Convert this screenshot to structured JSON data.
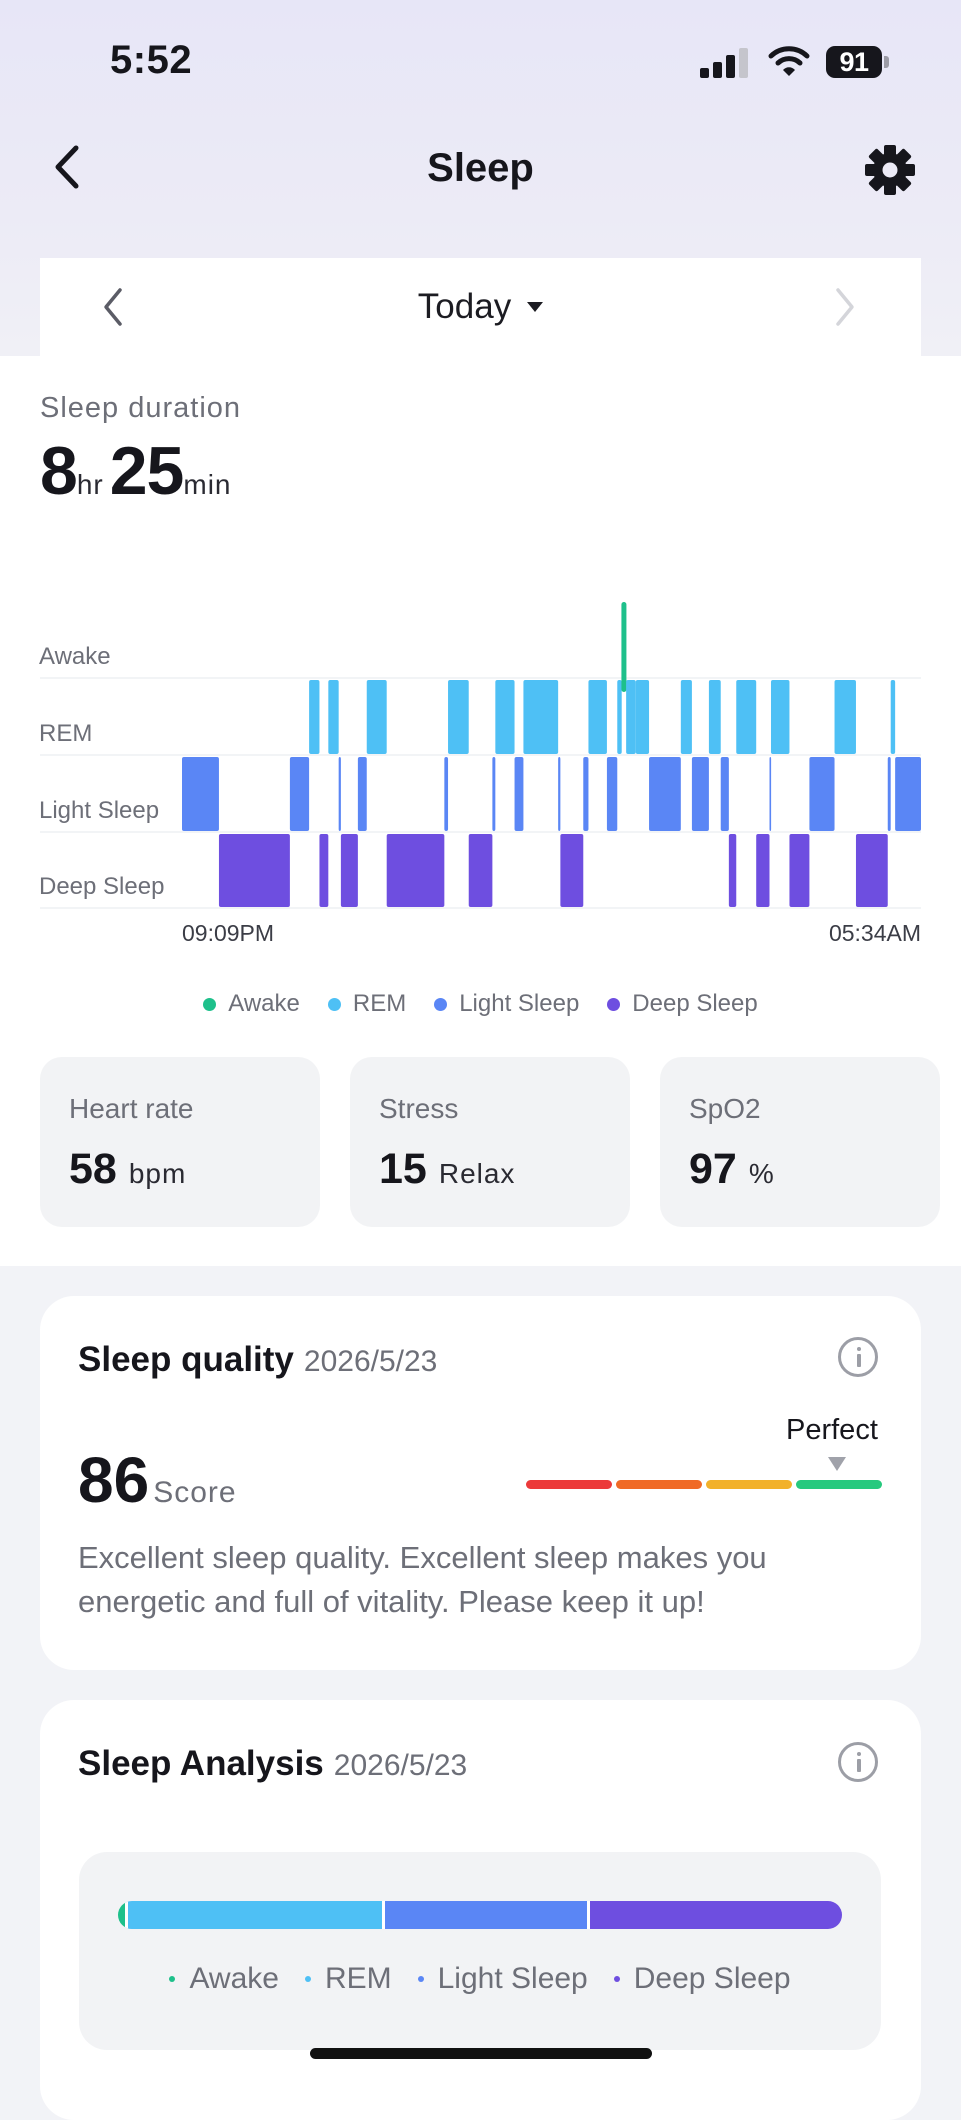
{
  "status_bar": {
    "time": "5:52",
    "battery": "91"
  },
  "header": {
    "title": "Sleep"
  },
  "date_nav": {
    "label": "Today"
  },
  "duration": {
    "label": "Sleep duration",
    "hours": "8",
    "hours_unit": "hr",
    "minutes": "25",
    "minutes_unit": "min"
  },
  "colors": {
    "awake": "#1ec08b",
    "rem": "#4ec0f5",
    "light": "#5a86f5",
    "deep": "#6e4ee0"
  },
  "chart_data": {
    "type": "timeline",
    "stages": [
      "Awake",
      "REM",
      "Light Sleep",
      "Deep Sleep"
    ],
    "start_label": "09:09PM",
    "end_label": "05:34AM",
    "segments": [
      {
        "stage": "Light Sleep",
        "start": 0.0,
        "end": 0.05
      },
      {
        "stage": "Deep Sleep",
        "start": 0.05,
        "end": 0.146
      },
      {
        "stage": "Light Sleep",
        "start": 0.146,
        "end": 0.172
      },
      {
        "stage": "REM",
        "start": 0.172,
        "end": 0.186
      },
      {
        "stage": "Deep Sleep",
        "start": 0.186,
        "end": 0.198
      },
      {
        "stage": "REM",
        "start": 0.198,
        "end": 0.212
      },
      {
        "stage": "Light Sleep",
        "start": 0.212,
        "end": 0.215
      },
      {
        "stage": "Deep Sleep",
        "start": 0.215,
        "end": 0.238
      },
      {
        "stage": "Light Sleep",
        "start": 0.238,
        "end": 0.25
      },
      {
        "stage": "REM",
        "start": 0.25,
        "end": 0.277
      },
      {
        "stage": "Deep Sleep",
        "start": 0.277,
        "end": 0.355
      },
      {
        "stage": "Light Sleep",
        "start": 0.355,
        "end": 0.36
      },
      {
        "stage": "REM",
        "start": 0.36,
        "end": 0.388
      },
      {
        "stage": "Deep Sleep",
        "start": 0.388,
        "end": 0.42
      },
      {
        "stage": "Light Sleep",
        "start": 0.42,
        "end": 0.424
      },
      {
        "stage": "REM",
        "start": 0.424,
        "end": 0.45
      },
      {
        "stage": "Light Sleep",
        "start": 0.45,
        "end": 0.462
      },
      {
        "stage": "REM",
        "start": 0.462,
        "end": 0.509
      },
      {
        "stage": "Light Sleep",
        "start": 0.509,
        "end": 0.512
      },
      {
        "stage": "Deep Sleep",
        "start": 0.512,
        "end": 0.543
      },
      {
        "stage": "Light Sleep",
        "start": 0.543,
        "end": 0.55
      },
      {
        "stage": "REM",
        "start": 0.55,
        "end": 0.575
      },
      {
        "stage": "Light Sleep",
        "start": 0.575,
        "end": 0.589
      },
      {
        "stage": "REM",
        "start": 0.589,
        "end": 0.595
      },
      {
        "stage": "Awake",
        "start": 0.595,
        "end": 0.601
      },
      {
        "stage": "REM",
        "start": 0.601,
        "end": 0.614
      },
      {
        "stage": "REM",
        "start": 0.614,
        "end": 0.632
      },
      {
        "stage": "Light Sleep",
        "start": 0.632,
        "end": 0.675
      },
      {
        "stage": "REM",
        "start": 0.675,
        "end": 0.69
      },
      {
        "stage": "Light Sleep",
        "start": 0.69,
        "end": 0.713
      },
      {
        "stage": "REM",
        "start": 0.713,
        "end": 0.729
      },
      {
        "stage": "Light Sleep",
        "start": 0.729,
        "end": 0.74
      },
      {
        "stage": "Deep Sleep",
        "start": 0.74,
        "end": 0.75
      },
      {
        "stage": "REM",
        "start": 0.75,
        "end": 0.777
      },
      {
        "stage": "Deep Sleep",
        "start": 0.777,
        "end": 0.795
      },
      {
        "stage": "Light Sleep",
        "start": 0.795,
        "end": 0.797
      },
      {
        "stage": "REM",
        "start": 0.797,
        "end": 0.822
      },
      {
        "stage": "Deep Sleep",
        "start": 0.822,
        "end": 0.849
      },
      {
        "stage": "Light Sleep",
        "start": 0.849,
        "end": 0.883
      },
      {
        "stage": "REM",
        "start": 0.883,
        "end": 0.912
      },
      {
        "stage": "Deep Sleep",
        "start": 0.912,
        "end": 0.955
      },
      {
        "stage": "Light Sleep",
        "start": 0.955,
        "end": 0.959
      },
      {
        "stage": "REM",
        "start": 0.959,
        "end": 0.965
      },
      {
        "stage": "Light Sleep",
        "start": 0.965,
        "end": 1.0
      }
    ]
  },
  "legend": [
    {
      "label": "Awake",
      "color": "#1ec08b"
    },
    {
      "label": "REM",
      "color": "#4ec0f5"
    },
    {
      "label": "Light Sleep",
      "color": "#5a86f5"
    },
    {
      "label": "Deep Sleep",
      "color": "#6e4ee0"
    }
  ],
  "metrics": {
    "heart_rate": {
      "title": "Heart rate",
      "value": "58",
      "unit": "bpm"
    },
    "stress": {
      "title": "Stress",
      "value": "15",
      "unit": "Relax"
    },
    "spo2": {
      "title": "SpO2",
      "value": "97",
      "unit": "%"
    }
  },
  "quality": {
    "title": "Sleep quality",
    "date": "2026/5/23",
    "score": "86",
    "score_unit": "Score",
    "level": "Perfect",
    "description": "Excellent sleep quality. Excellent sleep makes you energetic and full of vitality. Please keep it up!",
    "scale_colors": [
      "#ec3a3a",
      "#f06a26",
      "#f2b12a",
      "#27c97e"
    ]
  },
  "analysis": {
    "title": "Sleep Analysis",
    "date": "2026/5/23",
    "proportions": {
      "awake": 0.01,
      "rem": 0.35,
      "light": 0.28,
      "deep": 0.36
    },
    "legend": [
      "Awake",
      "REM",
      "Light Sleep",
      "Deep Sleep"
    ]
  }
}
